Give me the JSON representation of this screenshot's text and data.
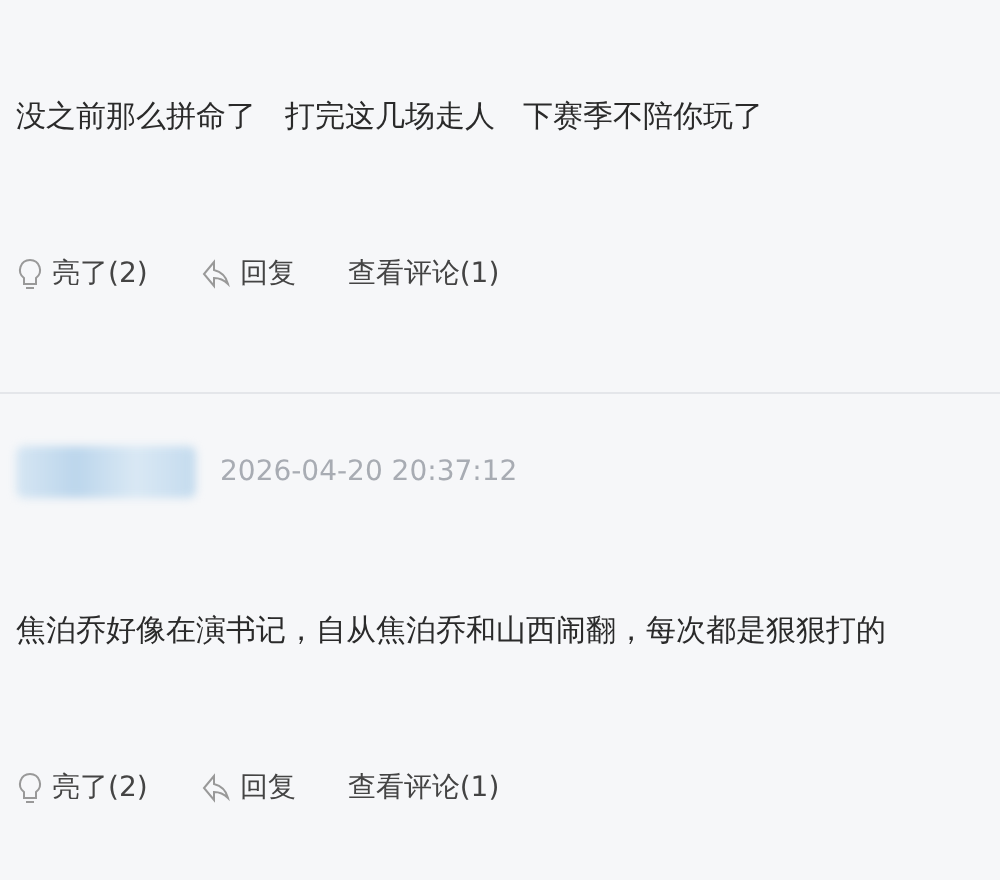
{
  "comments": [
    {
      "text": "没之前那么拼命了   打完这几场走人   下赛季不陪你玩了",
      "actions": {
        "like": "亮了(2)",
        "reply": "回复",
        "view": "查看评论(1)"
      }
    },
    {
      "author_blurred": true,
      "timestamp": "2026-04-20 20:37:12",
      "text": "焦泊乔好像在演书记，自从焦泊乔和山西闹翻，每次都是狠狠打的",
      "actions": {
        "like": "亮了(2)",
        "reply": "回复",
        "view": "查看评论(1)"
      }
    }
  ]
}
